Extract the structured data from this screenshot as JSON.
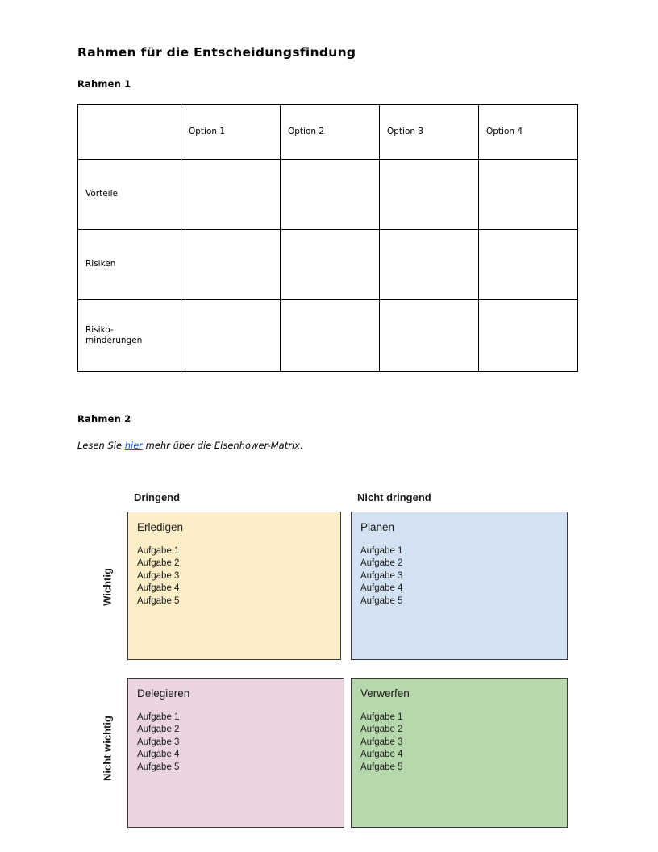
{
  "document": {
    "title": "Rahmen für die Entscheidungsfindung"
  },
  "section_one": {
    "heading": "Rahmen 1",
    "table": {
      "corner_label": "",
      "column_headers": [
        "Option 1",
        "Option 2",
        "Option 3",
        "Option 4"
      ],
      "rows": [
        {
          "label": "Vorteile",
          "label_line_1": "Vorteile",
          "label_line_2": "",
          "cells": [
            "",
            "",
            "",
            ""
          ]
        },
        {
          "label": "Risiken",
          "label_line_1": "Risiken",
          "label_line_2": "",
          "cells": [
            "",
            "",
            "",
            ""
          ]
        },
        {
          "label": "Risiko-minderungen",
          "label_line_1": "Risiko-",
          "label_line_2": "minderungen",
          "cells": [
            "",
            "",
            "",
            ""
          ]
        }
      ]
    }
  },
  "section_two": {
    "heading": "Rahmen 2",
    "intro": {
      "before_link": "Lesen Sie ",
      "link_text": "hier",
      "after_link": " mehr über die Eisenhower-Matrix."
    },
    "matrix": {
      "column_headers": [
        "Dringend",
        "Nicht dringend"
      ],
      "row_headers": [
        "Wichtig",
        "Nicht wichtig"
      ],
      "quadrants": [
        {
          "id": "do",
          "title": "Erledigen",
          "color": "#fdeec8",
          "tasks": [
            "Aufgabe 1",
            "Aufgabe 2",
            "Aufgabe 3",
            "Aufgabe 4",
            "Aufgabe 5"
          ]
        },
        {
          "id": "plan",
          "title": "Planen",
          "color": "#d2e2f2",
          "tasks": [
            "Aufgabe 1",
            "Aufgabe 2",
            "Aufgabe 3",
            "Aufgabe 4",
            "Aufgabe 5"
          ]
        },
        {
          "id": "delegate",
          "title": "Delegieren",
          "color": "#ead4e0",
          "tasks": [
            "Aufgabe 1",
            "Aufgabe 2",
            "Aufgabe 3",
            "Aufgabe 4",
            "Aufgabe 5"
          ]
        },
        {
          "id": "delete",
          "title": "Verwerfen",
          "color": "#b7d7ac",
          "tasks": [
            "Aufgabe 1",
            "Aufgabe 2",
            "Aufgabe 3",
            "Aufgabe 4",
            "Aufgabe 5"
          ]
        }
      ]
    }
  },
  "colors": {
    "link": "#1a56d6",
    "text": "#000000",
    "border": "#3b3b3b",
    "table_border": "#000000"
  }
}
